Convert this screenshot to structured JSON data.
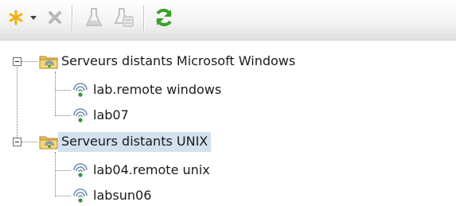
{
  "toolbar": {
    "buttons": [
      {
        "icon": "new-star-icon",
        "color": "#f2b010"
      },
      {
        "icon": "dropdown-arrow-icon",
        "color": "#444444"
      },
      {
        "icon": "delete-x-icon",
        "color": "#b9b9b9"
      },
      {
        "icon": "test-flask-icon",
        "color": "#c2c2c2"
      },
      {
        "icon": "test-details-icon",
        "color": "#c2c2c2"
      },
      {
        "icon": "refresh-icon",
        "color": "#3aa12b"
      }
    ]
  },
  "tree": {
    "groups": [
      {
        "label": "Serveurs distants Microsoft Windows",
        "selected": false,
        "expanded": true,
        "children": [
          {
            "label": "lab.remote windows"
          },
          {
            "label": "lab07"
          }
        ]
      },
      {
        "label": "Serveurs distants UNIX",
        "selected": true,
        "expanded": true,
        "children": [
          {
            "label": "lab04.remote unix"
          },
          {
            "label": "labsun06"
          }
        ]
      }
    ]
  },
  "colors": {
    "selection": "#d3e0ee",
    "folder": "#e6bf5a",
    "signal": "#6e8fae",
    "status_dot": "#2e9a3a"
  }
}
